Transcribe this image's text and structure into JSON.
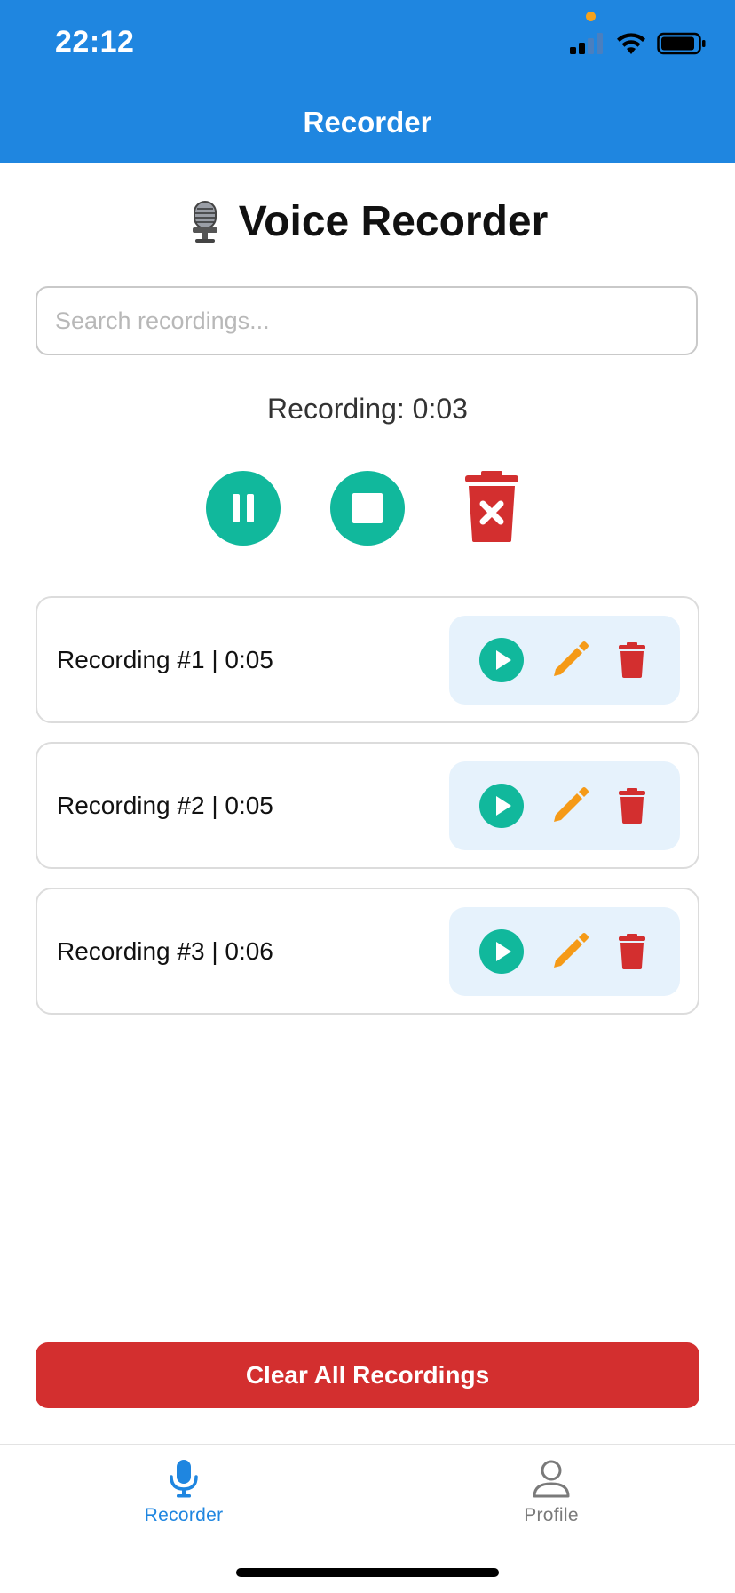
{
  "status_bar": {
    "time": "22:12"
  },
  "header": {
    "title": "Recorder"
  },
  "app": {
    "title": "Voice Recorder",
    "title_icon": "microphone-icon"
  },
  "search": {
    "placeholder": "Search recordings...",
    "value": ""
  },
  "recorder": {
    "status_text": "Recording: 0:03",
    "controls": [
      "pause-icon",
      "stop-icon",
      "discard-icon"
    ],
    "accent_color": "#11b89c",
    "danger_color": "#d32f2f"
  },
  "recordings": [
    {
      "label": "Recording #1 | 0:05"
    },
    {
      "label": "Recording #2 | 0:05"
    },
    {
      "label": "Recording #3 | 0:06"
    }
  ],
  "recording_actions": [
    "play-icon",
    "edit-icon",
    "trash-icon"
  ],
  "clear_button": {
    "label": "Clear All Recordings"
  },
  "tabs": [
    {
      "label": "Recorder",
      "icon": "microphone-icon",
      "active": true
    },
    {
      "label": "Profile",
      "icon": "person-icon",
      "active": false
    }
  ],
  "colors": {
    "header": "#1f86e0",
    "edit": "#f59a17",
    "delete": "#d32f2f",
    "action_bg": "#e6f2fc"
  }
}
